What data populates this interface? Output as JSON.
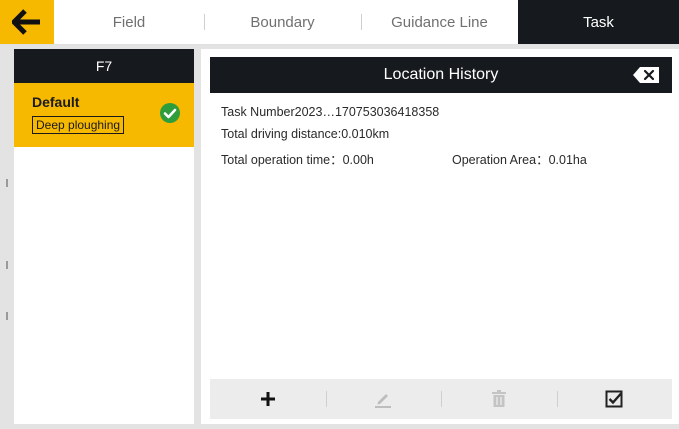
{
  "tabs": [
    {
      "label": "Field"
    },
    {
      "label": "Boundary"
    },
    {
      "label": "Guidance Line"
    },
    {
      "label": "Task"
    }
  ],
  "active_tab": "Task",
  "left_panel": {
    "header": "F7",
    "items": [
      {
        "name": "Default",
        "tag": "Deep ploughing",
        "status": "selected"
      }
    ]
  },
  "right_panel": {
    "title": "Location History",
    "task_number": "Task Number2023…170753036418358",
    "driving_distance": "Total driving distance:0.010km",
    "operation_time": "Total operation time：0.00h",
    "operation_area": "Operation Area：0.01ha"
  },
  "toolbar": {
    "buttons": [
      {
        "icon": "plus-icon",
        "enabled": true
      },
      {
        "icon": "pencil-icon",
        "enabled": false
      },
      {
        "icon": "trash-icon",
        "enabled": false
      },
      {
        "icon": "checkbox-icon",
        "enabled": true
      }
    ]
  },
  "colors": {
    "accent": "#f7b800",
    "dark": "#16191d",
    "check": "#2e9e3c"
  }
}
